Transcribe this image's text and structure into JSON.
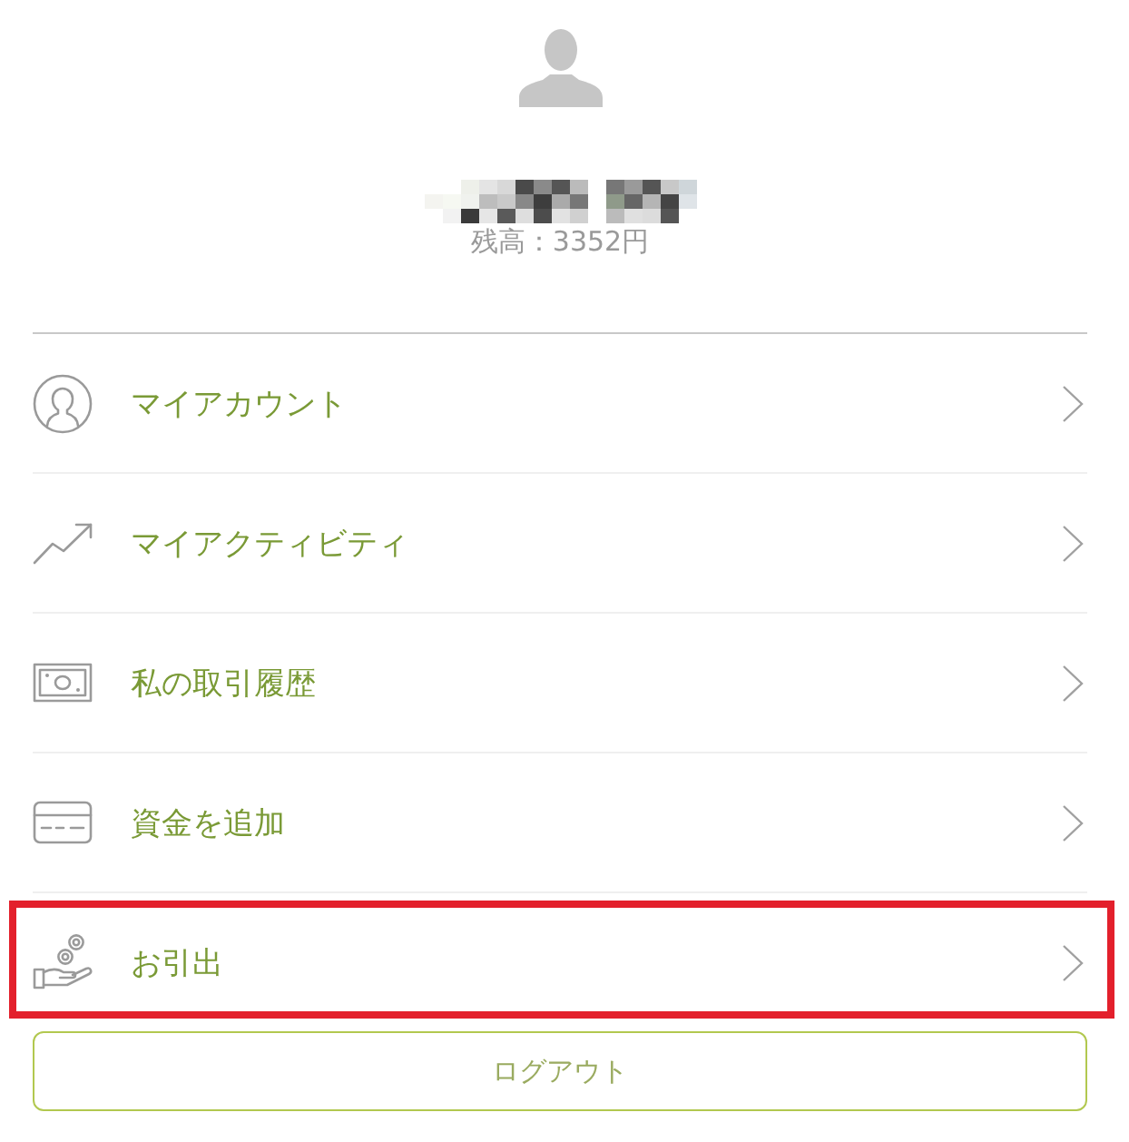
{
  "profile": {
    "balance": "残高：3352円"
  },
  "menu": [
    {
      "kind": "account",
      "label": "マイアカウント",
      "highlighted": false
    },
    {
      "kind": "activity",
      "label": "マイアクティビティ",
      "highlighted": false
    },
    {
      "kind": "history",
      "label": "私の取引履歴",
      "highlighted": false
    },
    {
      "kind": "deposit",
      "label": "資金を追加",
      "highlighted": false
    },
    {
      "kind": "withdraw",
      "label": "お引出",
      "highlighted": true
    }
  ],
  "logout_button": {
    "label": "ログアウト"
  }
}
